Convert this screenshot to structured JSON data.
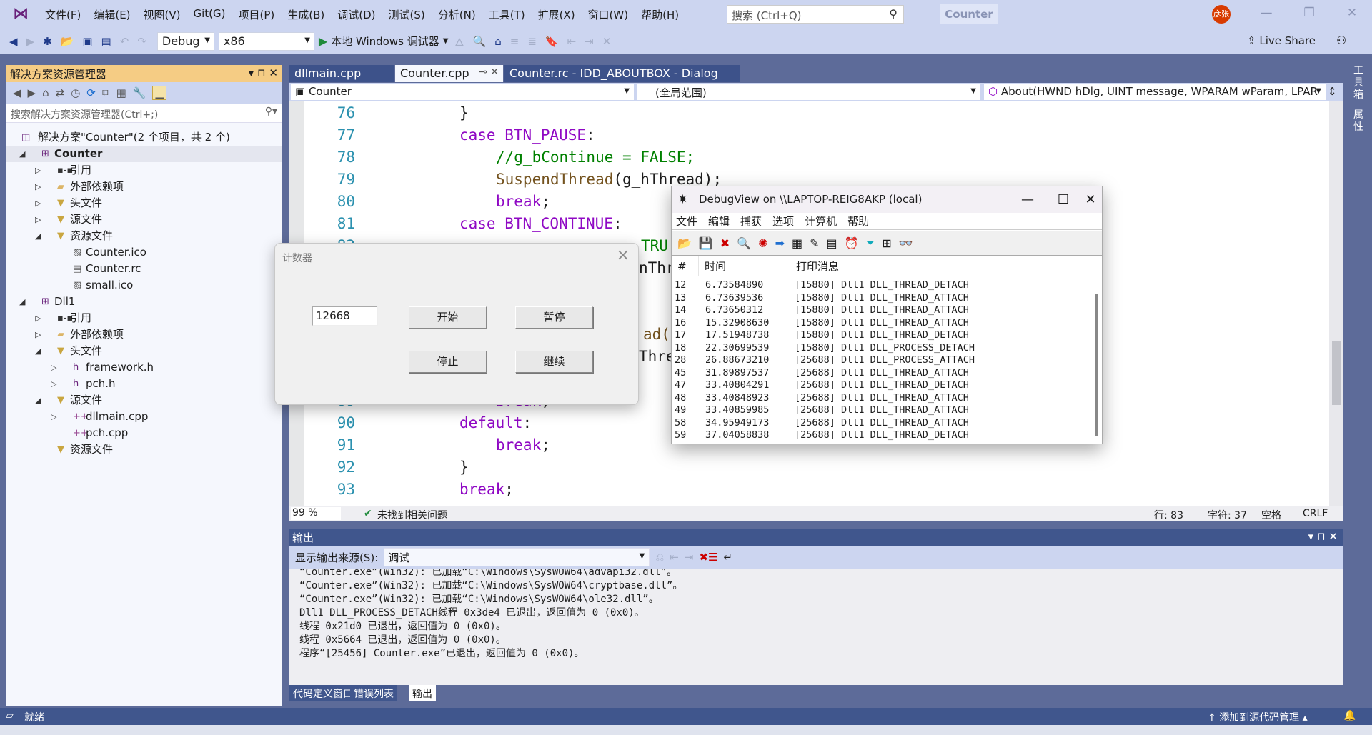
{
  "titlebar": {
    "menus": [
      "文件(F)",
      "编辑(E)",
      "视图(V)",
      "Git(G)",
      "项目(P)",
      "生成(B)",
      "调试(D)",
      "测试(S)",
      "分析(N)",
      "工具(T)",
      "扩展(X)",
      "窗口(W)",
      "帮助(H)"
    ],
    "search_placeholder": "搜索 (Ctrl+Q)",
    "project": "Counter",
    "avatar": "彦张"
  },
  "toolbar": {
    "config": "Debug",
    "platform": "x86",
    "run": "本地 Windows 调试器",
    "live_share": "Live Share"
  },
  "solution_explorer": {
    "title": "解决方案资源管理器",
    "search_placeholder": "搜索解决方案资源管理器(Ctrl+;)",
    "items": [
      {
        "label": "解决方案\"Counter\"(2 个项目，共 2 个)",
        "level": 0,
        "arrow": "",
        "icon": "solution-icon"
      },
      {
        "label": "Counter",
        "level": 1,
        "arrow": "expanded",
        "icon": "project-icon",
        "bold": true,
        "selected": true
      },
      {
        "label": "引用",
        "level": 2,
        "arrow": "collapsed",
        "icon": "references-icon"
      },
      {
        "label": "外部依赖项",
        "level": 2,
        "arrow": "collapsed",
        "icon": "folder-icon"
      },
      {
        "label": "头文件",
        "level": 2,
        "arrow": "collapsed",
        "icon": "filter-folder-icon"
      },
      {
        "label": "源文件",
        "level": 2,
        "arrow": "collapsed",
        "icon": "filter-folder-icon"
      },
      {
        "label": "资源文件",
        "level": 2,
        "arrow": "expanded",
        "icon": "filter-folder-icon"
      },
      {
        "label": "Counter.ico",
        "level": 3,
        "arrow": "",
        "icon": "image-file-icon"
      },
      {
        "label": "Counter.rc",
        "level": 3,
        "arrow": "",
        "icon": "resource-file-icon"
      },
      {
        "label": "small.ico",
        "level": 3,
        "arrow": "",
        "icon": "image-file-icon"
      },
      {
        "label": "Dll1",
        "level": 1,
        "arrow": "expanded",
        "icon": "project-icon"
      },
      {
        "label": "引用",
        "level": 2,
        "arrow": "collapsed",
        "icon": "references-icon"
      },
      {
        "label": "外部依赖项",
        "level": 2,
        "arrow": "collapsed",
        "icon": "folder-icon"
      },
      {
        "label": "头文件",
        "level": 2,
        "arrow": "expanded",
        "icon": "filter-folder-icon"
      },
      {
        "label": "framework.h",
        "level": 3,
        "arrow": "collapsed",
        "icon": "header-file-icon"
      },
      {
        "label": "pch.h",
        "level": 3,
        "arrow": "collapsed",
        "icon": "header-file-icon"
      },
      {
        "label": "源文件",
        "level": 2,
        "arrow": "expanded",
        "icon": "filter-folder-icon"
      },
      {
        "label": "dllmain.cpp",
        "level": 3,
        "arrow": "collapsed",
        "icon": "cpp-file-icon"
      },
      {
        "label": "pch.cpp",
        "level": 3,
        "arrow": "",
        "icon": "cpp-file-icon"
      },
      {
        "label": "资源文件",
        "level": 2,
        "arrow": "",
        "icon": "filter-folder-icon"
      }
    ]
  },
  "editor": {
    "tabs": [
      {
        "label": "dllmain.cpp"
      },
      {
        "label": "Counter.cpp",
        "active": true
      },
      {
        "label": "Counter.rc - IDD_ABOUTBOX - Dialog"
      }
    ],
    "nav": {
      "project": "Counter",
      "scope": "(全局范围)",
      "member": "About(HWND hDlg, UINT message, WPARAM wParam, LPAR"
    },
    "lines": [
      {
        "n": "76",
        "indent": 0,
        "parts": [
          [
            "}",
            ""
          ]
        ]
      },
      {
        "n": "77",
        "indent": 0,
        "parts": [
          [
            "case ",
            "kw"
          ],
          [
            "BTN_PAUSE",
            "mac"
          ],
          [
            ":",
            ""
          ]
        ]
      },
      {
        "n": "78",
        "indent": 1,
        "parts": [
          [
            "//g_bContinue = FALSE;",
            "cm"
          ]
        ]
      },
      {
        "n": "79",
        "indent": 1,
        "parts": [
          [
            "SuspendThread",
            "fn"
          ],
          [
            "(g_hThread);",
            ""
          ]
        ]
      },
      {
        "n": "80",
        "indent": 1,
        "parts": [
          [
            "break",
            "kw"
          ],
          [
            ";",
            ""
          ]
        ]
      },
      {
        "n": "81",
        "indent": 0,
        "parts": [
          [
            "case ",
            "kw"
          ],
          [
            "BTN_CONTINUE",
            "mac"
          ],
          [
            ":",
            ""
          ]
        ]
      },
      {
        "n": "82",
        "indent": 1,
        "parts": []
      },
      {
        "n": "83",
        "indent": 1,
        "parts": []
      },
      {
        "n": "84",
        "indent": 1,
        "parts": []
      },
      {
        "n": "85",
        "indent": 1,
        "parts": []
      },
      {
        "n": "86",
        "indent": 1,
        "parts": []
      },
      {
        "n": "87",
        "indent": 1,
        "parts": []
      },
      {
        "n": "88",
        "indent": 1,
        "parts": []
      },
      {
        "n": "89",
        "indent": 1,
        "parts": [
          [
            "break",
            "kw"
          ],
          [
            ";",
            ""
          ]
        ]
      },
      {
        "n": "90",
        "indent": 0,
        "parts": [
          [
            "default",
            "kw"
          ],
          [
            ":",
            ""
          ]
        ]
      },
      {
        "n": "91",
        "indent": 1,
        "parts": [
          [
            "break",
            "kw"
          ],
          [
            ";",
            ""
          ]
        ]
      },
      {
        "n": "92",
        "indent": 0,
        "parts": [
          [
            "}",
            ""
          ]
        ]
      },
      {
        "n": "93",
        "indent": 0,
        "parts": [
          [
            "break",
            "kw"
          ],
          [
            ";",
            ""
          ]
        ]
      }
    ],
    "fragments": [
      "TRU",
      "nThr",
      "ad(g",
      "Thre"
    ],
    "status": {
      "zoom": "99 %",
      "issues": "未找到相关问题",
      "line": "行: 83",
      "char": "字符: 37",
      "spaces": "空格",
      "eol": "CRLF"
    }
  },
  "output": {
    "title": "输出",
    "source_label": "显示输出来源(S):",
    "source": "调试",
    "lines": [
      "“Counter.exe”(Win32): 已加载“C:\\Windows\\SysWOW64\\advapi32.dll”。",
      "“Counter.exe”(Win32): 已加载“C:\\Windows\\SysWOW64\\cryptbase.dll”。",
      "“Counter.exe”(Win32): 已加载“C:\\Windows\\SysWOW64\\ole32.dll”。",
      "Dll1 DLL_PROCESS_DETACH线程 0x3de4 已退出，返回值为 0 (0x0)。",
      "线程 0x21d0 已退出，返回值为 0 (0x0)。",
      "线程 0x5664 已退出，返回值为 0 (0x0)。",
      "程序“[25456] Counter.exe”已退出，返回值为 0 (0x0)。"
    ],
    "tabs": [
      {
        "label": "代码定义窗口"
      },
      {
        "label": "错误列表"
      },
      {
        "label": "输出",
        "active": true
      }
    ]
  },
  "right_tabs": [
    "工具箱",
    "属性"
  ],
  "statusbar": {
    "ready": "就绪",
    "source_control": "添加到源代码管理"
  },
  "counter_dialog": {
    "title": "计数器",
    "value": "12668",
    "buttons": [
      "开始",
      "暂停",
      "停止",
      "继续"
    ]
  },
  "debugview": {
    "title": "DebugView on \\\\LAPTOP-REIG8AKP (local)",
    "menus": [
      "文件",
      "编辑",
      "捕获",
      "选项",
      "计算机",
      "帮助"
    ],
    "columns": [
      "#",
      "时间",
      "打印消息"
    ],
    "rows": [
      [
        "12",
        "6.73584890",
        "[15880] Dll1 DLL_THREAD_DETACH"
      ],
      [
        "13",
        "6.73639536",
        "[15880] Dll1 DLL_THREAD_ATTACH"
      ],
      [
        "14",
        "6.73650312",
        "[15880] Dll1 DLL_THREAD_ATTACH"
      ],
      [
        "16",
        "15.32908630",
        "[15880] Dll1 DLL_THREAD_ATTACH"
      ],
      [
        "17",
        "17.51948738",
        "[15880] Dll1 DLL_THREAD_DETACH"
      ],
      [
        "18",
        "22.30699539",
        "[15880] Dll1 DLL_PROCESS_DETACH"
      ],
      [
        "28",
        "26.88673210",
        "[25688] Dll1 DLL_PROCESS_ATTACH"
      ],
      [
        "45",
        "31.89897537",
        "[25688] Dll1 DLL_THREAD_ATTACH"
      ],
      [
        "47",
        "33.40804291",
        "[25688] Dll1 DLL_THREAD_DETACH"
      ],
      [
        "48",
        "33.40848923",
        "[25688] Dll1 DLL_THREAD_ATTACH"
      ],
      [
        "49",
        "33.40859985",
        "[25688] Dll1 DLL_THREAD_ATTACH"
      ],
      [
        "58",
        "34.95949173",
        "[25688] Dll1 DLL_THREAD_ATTACH"
      ],
      [
        "59",
        "37.04058838",
        "[25688] Dll1 DLL_THREAD_DETACH"
      ]
    ]
  },
  "colors": {
    "ide_bg": "#ccd5f0",
    "accent": "#40568d",
    "se_header": "#f5cc84",
    "keyword": "#8f08c4",
    "comment": "#008000",
    "line_number": "#2b91af"
  }
}
